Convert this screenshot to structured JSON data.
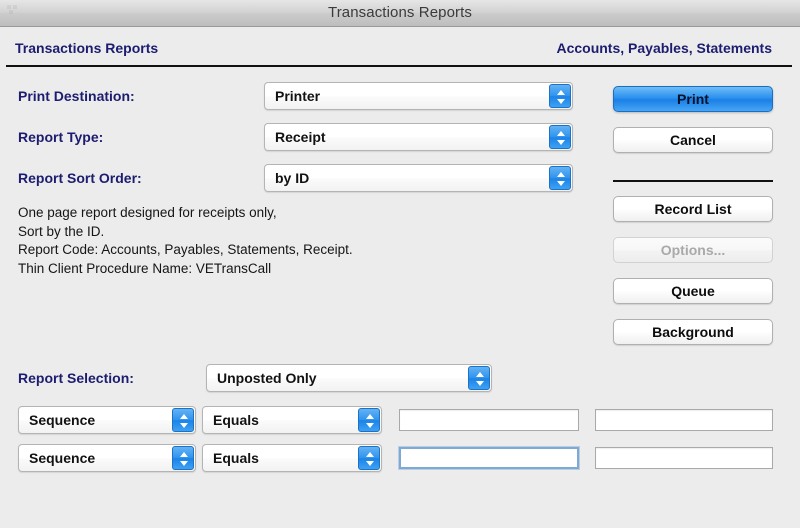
{
  "window": {
    "title": "Transactions Reports"
  },
  "header": {
    "left_title": "Transactions Reports",
    "right_title": "Accounts, Payables, Statements"
  },
  "colors": {
    "label_navy": "#1c1c70",
    "accent_blue": "#2a90ee",
    "background": "#ececec",
    "focus_ring": "#7ea9d6"
  },
  "form": {
    "print_destination": {
      "label": "Print Destination:",
      "value": "Printer"
    },
    "report_type": {
      "label": "Report Type:",
      "value": "Receipt"
    },
    "report_sort_order": {
      "label": "Report Sort Order:",
      "value": "by ID"
    }
  },
  "description": "One page report designed for receipts only,\nSort by the ID.\nReport Code: Accounts, Payables, Statements, Receipt.\nThin Client Procedure Name: VETransCall",
  "buttons": [
    {
      "label": "Print",
      "state": "primary"
    },
    {
      "label": "Cancel",
      "state": "normal"
    },
    {
      "label": "Record List",
      "state": "normal"
    },
    {
      "label": "Options...",
      "state": "disabled"
    },
    {
      "label": "Queue",
      "state": "normal"
    },
    {
      "label": "Background",
      "state": "normal"
    }
  ],
  "selection": {
    "label": "Report Selection:",
    "value": "Unposted Only",
    "rows": [
      {
        "field": "Sequence",
        "operator": "Equals",
        "value_1": "",
        "value_2": "",
        "focused": false
      },
      {
        "field": "Sequence",
        "operator": "Equals",
        "value_1": "",
        "value_2": "",
        "focused": true
      }
    ]
  },
  "icons": {
    "popup_arrows": "up-down-chevron-icon",
    "window_controls": "window-controls-icon"
  }
}
